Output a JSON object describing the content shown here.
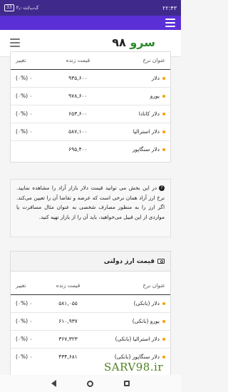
{
  "statusbar": {
    "battery": "33",
    "net_speed": "۲٫۰ک‌ب/ث",
    "time": "۲۲:۴۳"
  },
  "header": {
    "logo_sarv": "سرو",
    "logo_num": "۹۸"
  },
  "table1": {
    "headers": {
      "name": "عنوان نرخ",
      "price": "قیمت زنده",
      "change": "تغییر"
    },
    "rows": [
      {
        "name": "دلار",
        "price": "۹۳۵,۶۰۰",
        "change": "(۰%) ۰"
      },
      {
        "name": "یورو",
        "price": "۹۷۸,۶۰۰",
        "change": "(۰%) ۰"
      },
      {
        "name": "دلار کانادا",
        "price": "۶۵۳,۶۰۰",
        "change": "(۰%) ۰"
      },
      {
        "name": "دلار استرالیا",
        "price": "۵۸۷,۱۰۰",
        "change": "(۰%) ۰"
      },
      {
        "name": "دلار سنگاپور",
        "price": "۶۹۵,۴۰۰",
        "change": ""
      }
    ]
  },
  "note": {
    "text": "در این بخش می توانید قیمت دلار بازار آزاد را مشاهده نمایید. نرخ ارز آزاد همان نرخی است که عرضه و تقاضا آن را تعیین می‌کند. اگر ارز را به منظور مصارف شخصی به عنوان مثال مسافرت یا مواردی از این قبیل می‌خواهید، باید آن را از بازار تهیه کنید."
  },
  "table2": {
    "title": "قیمت ارز دولتی",
    "headers": {
      "name": "عنوان نرخ",
      "price": "قیمت زنده",
      "change": "تغییر"
    },
    "rows": [
      {
        "name": "دلار (بانکی)",
        "price": "۵۸۱,۰۵۵",
        "change": "(۰%) ۰"
      },
      {
        "name": "یورو (بانکی)",
        "price": "۶۱۰,۹۳۷",
        "change": "(۰%) ۰"
      },
      {
        "name": "دلار استرالیا (بانکی)",
        "price": "۳۶۷,۳۲۳",
        "change": "(۰%) ۰"
      },
      {
        "name": "دلار سنگاپور (بانکی)",
        "price": "۴۳۴,۶۸۱",
        "change": "(۰%) ۰"
      }
    ]
  },
  "watermark": "SARV98.ir"
}
